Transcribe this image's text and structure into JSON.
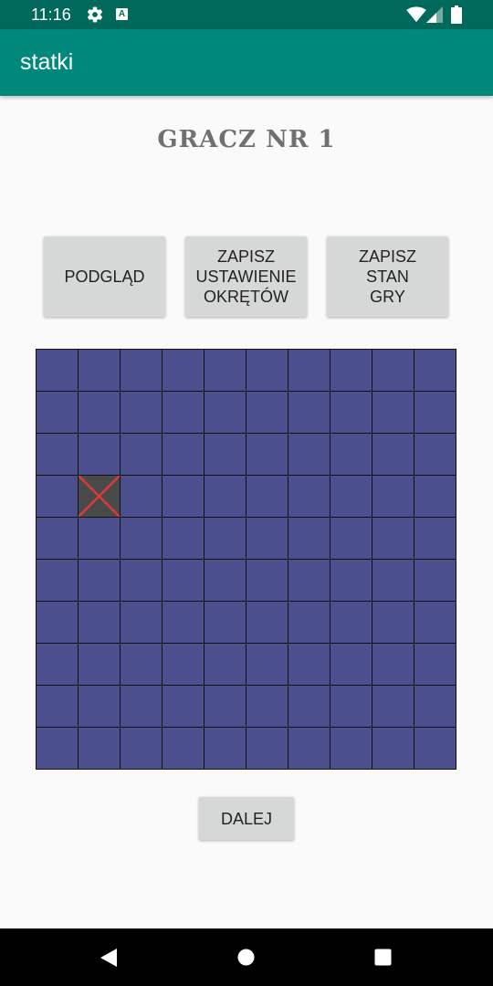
{
  "status_bar": {
    "time": "11:16",
    "icons": [
      "gear-icon",
      "a-icon",
      "wifi-icon",
      "signal-icon",
      "battery-icon"
    ]
  },
  "app_bar": {
    "title": "statki"
  },
  "screen": {
    "player_title": "GRACZ NR 1",
    "buttons": {
      "preview": "PODGLĄD",
      "save_ships": "ZAPISZ\nUSTAWIENIE\nOKRĘTÓW",
      "save_game": "ZAPISZ\nSTAN\nGRY",
      "next": "DALEJ"
    }
  },
  "board": {
    "rows": 10,
    "cols": 10,
    "hits": [
      {
        "row": 4,
        "col": 2
      }
    ]
  },
  "colors": {
    "status_bar": "#00695c",
    "app_bar": "#00897b",
    "water_cell": "#4b4f8d",
    "hit_cell": "#4a4a4a",
    "hit_mark": "#e53935",
    "button": "#d6d7d7"
  },
  "nav_bar": {
    "icons": [
      "back-icon",
      "home-icon",
      "recents-icon"
    ]
  }
}
